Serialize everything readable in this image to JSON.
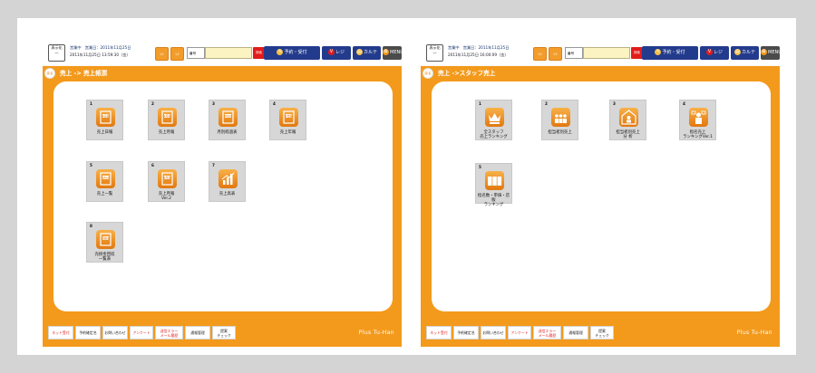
{
  "screens": [
    {
      "mode_badge": "表示化\n―",
      "status_line": "営業中　営業日：2011年11月25日",
      "date_line": "2011年11月25日 13:59:30（金）",
      "small_buttons": [
        "ﾚｼ",
        "ﾚｼ"
      ],
      "search_label": "番号",
      "search_button": "検索",
      "nav_buttons": [
        {
          "label": "予約・受付",
          "icon": "pencil-icon",
          "glyph": "✎"
        },
        {
          "label": "レジ",
          "icon": "register-icon",
          "glyph": "V"
        },
        {
          "label": "カルテ",
          "icon": "chart-icon",
          "glyph": "▤"
        },
        {
          "label": "MENU",
          "icon": "menu-icon",
          "glyph": "✿"
        }
      ],
      "back_label": "戻る",
      "breadcrumb": "売上 -> 売上帳票",
      "tiles": [
        {
          "number": "1",
          "label": "売上日報",
          "icon": "daily-report-icon",
          "icon_text": "¥日報"
        },
        {
          "number": "2",
          "label": "売上月報",
          "icon": "monthly-report-icon",
          "icon_text": "¥月報"
        },
        {
          "number": "3",
          "label": "月別経過表",
          "icon": "monthly-progress-icon",
          "icon_text": "FREE"
        },
        {
          "number": "4",
          "label": "売上年報",
          "icon": "annual-report-icon",
          "icon_text": "¥年報"
        },
        {
          "number": "5",
          "label": "売上一覧",
          "icon": "sales-list-icon",
          "icon_text": "SALE"
        },
        {
          "number": "6",
          "label": "売上月報\nVer.2",
          "icon": "monthly-report-v2-icon",
          "icon_text": "¥月報"
        },
        {
          "number": "7",
          "label": "売上高表",
          "icon": "sales-chart-icon",
          "icon_text": ""
        },
        {
          "number": "8",
          "label": "売掛金回収\n一覧表",
          "icon": "receivables-icon",
          "icon_text": "売掛金"
        }
      ],
      "footer_buttons": [
        {
          "label": "ネット受付",
          "red": true
        },
        {
          "label": "予約確定名",
          "red": false
        },
        {
          "label": "お問い合わせ",
          "red": false
        },
        {
          "label": "アンケート",
          "red": true
        },
        {
          "label": "送信エラー\nメール履歴",
          "red": true
        },
        {
          "label": "通報管理",
          "red": false
        },
        {
          "label": "提案\nチェック",
          "red": false
        }
      ],
      "brand": "Plus Tu-Han"
    },
    {
      "mode_badge": "表示化\n―",
      "status_line": "営業中　営業日：2011年11月25日",
      "date_line": "2011年11月25日 16:00:09（金）",
      "small_buttons": [
        "ﾚｼ",
        "ﾚｼ"
      ],
      "search_label": "番号",
      "search_button": "検索",
      "nav_buttons": [
        {
          "label": "予約・受付",
          "icon": "pencil-icon",
          "glyph": "✎"
        },
        {
          "label": "レジ",
          "icon": "register-icon",
          "glyph": "V"
        },
        {
          "label": "カルテ",
          "icon": "chart-icon",
          "glyph": "▤"
        },
        {
          "label": "MENU",
          "icon": "menu-icon",
          "glyph": "✿"
        }
      ],
      "back_label": "戻る",
      "breadcrumb": "売上 ->スタッフ売上",
      "tiles": [
        {
          "number": "1",
          "label": "全スタッフ\n売上ランキング",
          "icon": "staff-ranking-icon",
          "icon_text": ""
        },
        {
          "number": "2",
          "label": "担当者別売上",
          "icon": "staff-sales-icon",
          "icon_text": ""
        },
        {
          "number": "3",
          "label": "担当者別売上\n分 析",
          "icon": "staff-analysis-icon",
          "icon_text": ""
        },
        {
          "number": "4",
          "label": "指名売上\nランキングVer.1",
          "icon": "nomination-ranking-icon",
          "icon_text": ""
        },
        {
          "number": "5",
          "label": "指名数・単価・店販\nランキング",
          "icon": "nomination-count-icon",
          "icon_text": ""
        }
      ],
      "footer_buttons": [
        {
          "label": "ネット受付",
          "red": true
        },
        {
          "label": "予約確定名",
          "red": false
        },
        {
          "label": "お問い合わせ",
          "red": false
        },
        {
          "label": "アンケート",
          "red": true
        },
        {
          "label": "送信エラー\nメール履歴",
          "red": true
        },
        {
          "label": "通報管理",
          "red": false
        },
        {
          "label": "提案\nチェック",
          "red": false
        }
      ],
      "brand": "Plus Tu-Han"
    }
  ],
  "colors": {
    "orange": "#f39a1c",
    "navy": "#233b8c",
    "red": "#e21b1b",
    "tile": "#d7d7d7"
  }
}
